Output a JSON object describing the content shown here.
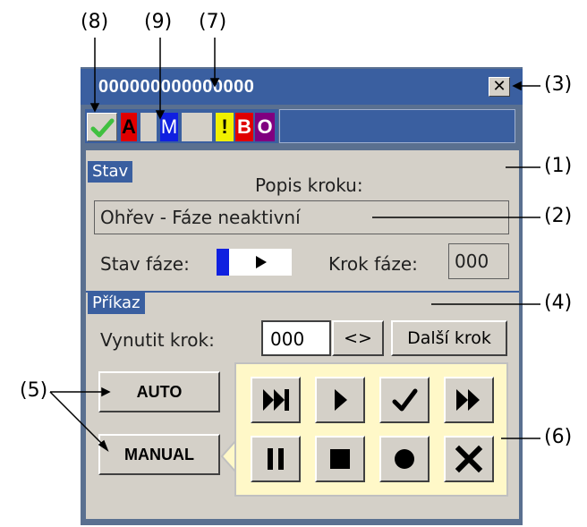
{
  "callouts": [
    "(8)",
    "(9)",
    "(7)",
    "(3)",
    "(1)",
    "(2)",
    "(4)",
    "(5)",
    "(6)"
  ],
  "window": {
    "title": "000000000000000",
    "close_glyph": "✕"
  },
  "indicators": [
    {
      "text": "",
      "icon": "checkmark-icon",
      "bg": "#d4d0c8",
      "fg": "#40c040"
    },
    {
      "text": "A",
      "bg": "#e00000",
      "fg": "#000000"
    },
    {
      "text": "",
      "bg": "#d4d0c8",
      "fg": "#000000"
    },
    {
      "text": "M",
      "bg": "#1020e0",
      "fg": "#ffffff"
    },
    {
      "text": "",
      "bg": "#d4d0c8",
      "fg": "#000000"
    },
    {
      "text": "!",
      "bg": "#f0f000",
      "fg": "#000000"
    },
    {
      "text": "B",
      "bg": "#e00000",
      "fg": "#ffffff"
    },
    {
      "text": "O",
      "bg": "#800080",
      "fg": "#ffffff"
    }
  ],
  "stav": {
    "section": "Stav",
    "popis_label": "Popis kroku:",
    "popis_value": "Ohřev - Fáze neaktivní",
    "stav_faze_label": "Stav fáze:",
    "krok_faze_label": "Krok fáze:",
    "krok_faze_value": "000"
  },
  "prikaz": {
    "section": "Příkaz",
    "vynutit_label": "Vynutit krok:",
    "vynutit_value": "000",
    "swap_label": "<>",
    "dalsi_label": "Další krok",
    "auto_label": "AUTO",
    "manual_label": "MANUAL"
  },
  "controls": [
    {
      "name": "skip-to-end-icon",
      "glyph": "⏭"
    },
    {
      "name": "play-icon",
      "glyph": "▶"
    },
    {
      "name": "check-icon",
      "glyph": "✔"
    },
    {
      "name": "fast-forward-icon",
      "glyph": "⏩"
    },
    {
      "name": "pause-icon",
      "glyph": "⏸"
    },
    {
      "name": "stop-icon",
      "glyph": "■"
    },
    {
      "name": "record-icon",
      "glyph": "●"
    },
    {
      "name": "abort-icon",
      "glyph": "✖"
    }
  ],
  "colors": {
    "accent": "#3a5fa0",
    "panel": "#d4d0c8",
    "control_bg": "#fff8c8"
  }
}
